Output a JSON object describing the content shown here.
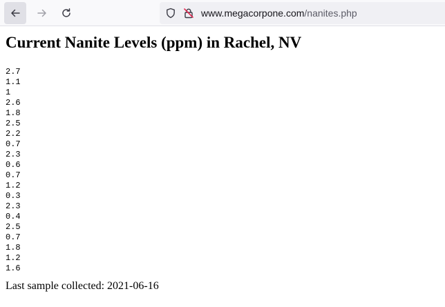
{
  "browser": {
    "url_host": "www.megacorpone.com",
    "url_path": "/nanites.php"
  },
  "page": {
    "title": "Current Nanite Levels (ppm) in Rachel, NV",
    "readings": [
      "2.7",
      "1.1",
      "1",
      "2.6",
      "1.8",
      "2.5",
      "2.2",
      "0.7",
      "2.3",
      "0.6",
      "0.7",
      "1.2",
      "0.3",
      "2.3",
      "0.4",
      "2.5",
      "0.7",
      "1.8",
      "1.2",
      "1.6"
    ],
    "footer": "Last sample collected: 2021-06-16"
  },
  "icons": {
    "back": "back-arrow-icon",
    "forward": "forward-arrow-icon",
    "reload": "reload-icon",
    "tracking": "shield-icon",
    "security": "insecure-lock-icon"
  },
  "colors": {
    "toolbar_bg": "#f9f9fb",
    "urlbar_bg": "#f0f0f4",
    "insecure_red": "#e22850"
  }
}
